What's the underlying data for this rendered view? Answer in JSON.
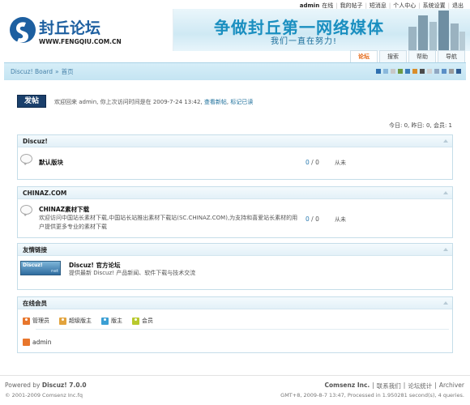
{
  "topbar": {
    "user": "admin",
    "status": "在线",
    "links": [
      "我的帖子",
      "短消息",
      "个人中心",
      "系统设置",
      "退出"
    ]
  },
  "header": {
    "logo_name": "封丘论坛",
    "logo_url_text": "WWW.FENGQIU.COM.CN",
    "slogan_main": "争做封丘第一网络媒体",
    "slogan_sub": "我们一直在努力!"
  },
  "nav": {
    "tabs": [
      "论坛",
      "搜索",
      "帮助",
      "导航"
    ],
    "active": "论坛"
  },
  "breadcrumb": {
    "home": "Discuz! Board",
    "separator": "»",
    "current": "首页"
  },
  "theme_swatches": [
    "#2e6fb0",
    "#8ab8dc",
    "#c8c8c8",
    "#6f9a41",
    "#3b7cb8",
    "#d98d2b",
    "#4b4b4b",
    "#d0d0d0",
    "#8fa7c2",
    "#5a8fc7",
    "#9a9a9a",
    "#2f5d94"
  ],
  "post_button": "发帖",
  "welcome": {
    "text": "欢迎回来 admin, 你上次访问时间是在 2009-7-24 13:42,",
    "link1": "查看新帖",
    "comma": ",",
    "link2": "标记已读"
  },
  "stats": "今日: 0, 昨日: 0, 会员: 1",
  "categories": [
    {
      "title": "Discuz!",
      "forums": [
        {
          "name": "默认版块",
          "desc": "",
          "threads": "0",
          "posts": "0",
          "last": "从未"
        }
      ]
    },
    {
      "title": "CHINAZ.COM",
      "forums": [
        {
          "name": "CHINAZ素材下载",
          "desc": "欢迎访问中国站长素材下载,中国站长站推出素材下载站(SC.CHINAZ.COM),为支持和喜爱站长素材的用户提供更多专业的素材下载",
          "threads": "0",
          "posts": "0",
          "last": "从未"
        }
      ]
    }
  ],
  "friend_links": {
    "title": "友情链接",
    "logo_text": "Discuz!",
    "logo_sub": "net",
    "name": "Discuz! 官方论坛",
    "desc": "提供最新 Discuz! 产品新闻、软件下载与技术交流"
  },
  "online": {
    "title": "在线会员",
    "legend": [
      {
        "label": "管理员",
        "color": "#e8762c"
      },
      {
        "label": "超级版主",
        "color": "#e2a33d"
      },
      {
        "label": "版主",
        "color": "#3b9fd4"
      },
      {
        "label": "会员",
        "color": "#b8c92d"
      }
    ],
    "users": [
      "admin"
    ]
  },
  "footer": {
    "powered_prefix": "Powered by ",
    "powered_brand": "Discuz! 7.0.0",
    "copyright": "© 2001-2009 Comsenz Inc.fq",
    "company": "Comsenz Inc.",
    "links": [
      "联系我们",
      "论坛统计",
      "Archiver"
    ],
    "processed": "GMT+8, 2009-8-7 13:47, Processed in 1.950281 second(s), 4 queries."
  }
}
